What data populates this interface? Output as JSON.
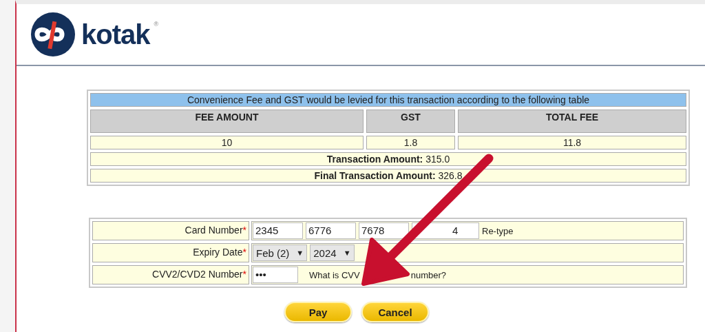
{
  "header": {
    "logo_text": "kotak",
    "logo_mark": "®"
  },
  "fee_table": {
    "caption": "Convenience Fee and GST would be levied for this transaction according to the following table",
    "columns": [
      "FEE AMOUNT",
      "GST",
      "TOTAL FEE"
    ],
    "row": [
      "10",
      "1.8",
      "11.8"
    ],
    "totals": [
      {
        "label": "Transaction Amount:",
        "value": "315.0"
      },
      {
        "label": "Final Transaction Amount:",
        "value": "326.8"
      }
    ]
  },
  "card_form": {
    "card_number": {
      "label": "Card Number",
      "required": true,
      "parts": [
        "2345",
        "6776",
        "7678",
        "4"
      ],
      "hint": "Re-type"
    },
    "expiry": {
      "label": "Expiry Date",
      "required": true,
      "month": "Feb (2)",
      "year": "2024",
      "arrow": "▼"
    },
    "cvv": {
      "label": "CVV2/CVD2 Number",
      "required": true,
      "value": "•••",
      "help": [
        "What is CVV",
        "number?"
      ]
    },
    "required_mark": "*"
  },
  "buttons": [
    "Pay",
    "Cancel"
  ]
}
